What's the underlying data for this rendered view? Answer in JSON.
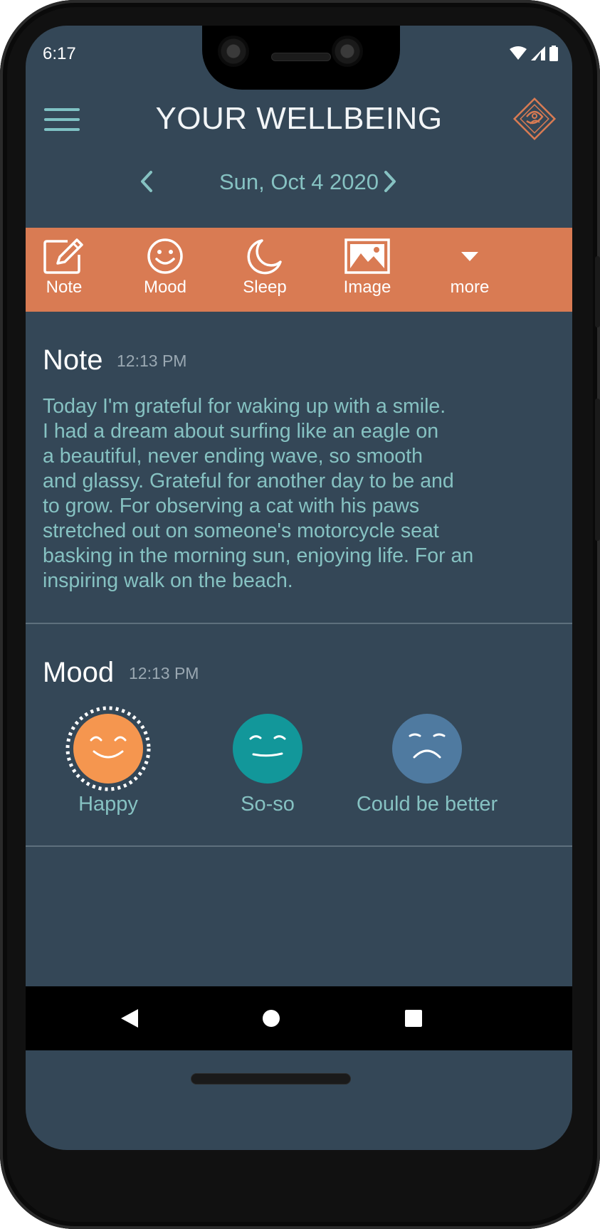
{
  "status_bar": {
    "time": "6:17"
  },
  "app_bar": {
    "title": "YOUR WELLBEING",
    "menu_icon": "hamburger-menu-icon",
    "logo_icon": "diamond-logo-icon"
  },
  "date_nav": {
    "date": "Sun, Oct 4 2020",
    "prev_icon": "chevron-left-icon",
    "next_icon": "chevron-right-icon"
  },
  "toolbar": {
    "items": [
      {
        "label": "Note",
        "icon": "pencil-note-icon"
      },
      {
        "label": "Mood",
        "icon": "smiley-icon"
      },
      {
        "label": "Sleep",
        "icon": "moon-icon"
      },
      {
        "label": "Image",
        "icon": "image-icon"
      },
      {
        "label": "more",
        "icon": "caret-down-icon"
      }
    ]
  },
  "note": {
    "title": "Note",
    "time": "12:13 PM",
    "text": "Today I'm grateful for waking up with a smile.\nI had a dream about surfing like an eagle on\na beautiful, never ending wave, so smooth\nand glassy. Grateful for another day to be and\nto grow. For observing a cat with his paws\nstretched out on someone's motorcycle seat\nbasking in the morning sun, enjoying life. For an\ninspiring walk on the beach."
  },
  "mood": {
    "title": "Mood",
    "time": "12:13 PM",
    "options": [
      {
        "label": "Happy",
        "color": "#f5964f",
        "selected": true,
        "icon": "happy-face-icon"
      },
      {
        "label": "So-so",
        "color": "#12979a",
        "selected": false,
        "icon": "neutral-face-icon"
      },
      {
        "label": "Could be better",
        "color": "#4f7aa0",
        "selected": false,
        "icon": "sad-face-icon"
      }
    ]
  },
  "colors": {
    "background": "#344757",
    "accent": "#d97b53",
    "teal_text": "#86c2c2"
  }
}
